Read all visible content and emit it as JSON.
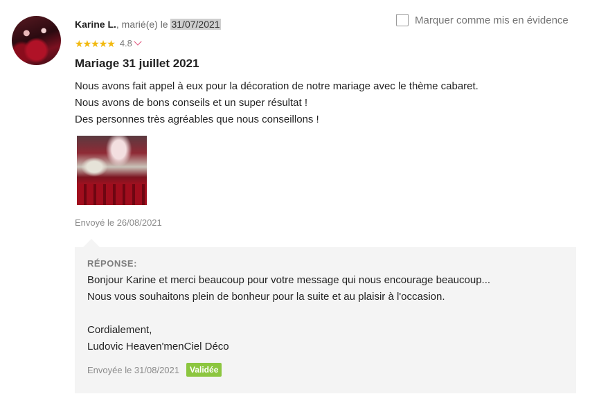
{
  "review": {
    "author": "Karine L.",
    "married_prefix": ", marié(e) le ",
    "wedding_date": "31/07/2021",
    "rating": "4.8",
    "star_count": 5,
    "title": "Mariage 31 juillet 2021",
    "body": [
      "Nous avons fait appel à eux pour la décoration de notre mariage avec le thème cabaret.",
      "Nous avons de bons conseils et un super résultat !",
      "Des personnes très agréables que nous conseillons !"
    ],
    "sent_date": "Envoyé le 26/08/2021"
  },
  "highlight": {
    "label": "Marquer comme mis en évidence"
  },
  "reply": {
    "label": "RÉPONSE:",
    "lines": [
      "Bonjour Karine et merci beaucoup pour votre message qui nous encourage beaucoup...",
      "Nous vous souhaitons plein de bonheur pour la suite et au plaisir à l'occasion.",
      "",
      "Cordialement,",
      "Ludovic Heaven'menCiel Déco"
    ],
    "sent_date": "Envoyée le 31/08/2021",
    "status_badge": "Validée"
  },
  "colors": {
    "star": "#f2b90f",
    "chevron": "#e0507a",
    "badge": "#8cc63f",
    "reply_background": "#f4f4f4"
  },
  "icons": {
    "star": "star-icon",
    "chevron": "chevron-down-icon",
    "checkbox": "checkbox-icon"
  }
}
